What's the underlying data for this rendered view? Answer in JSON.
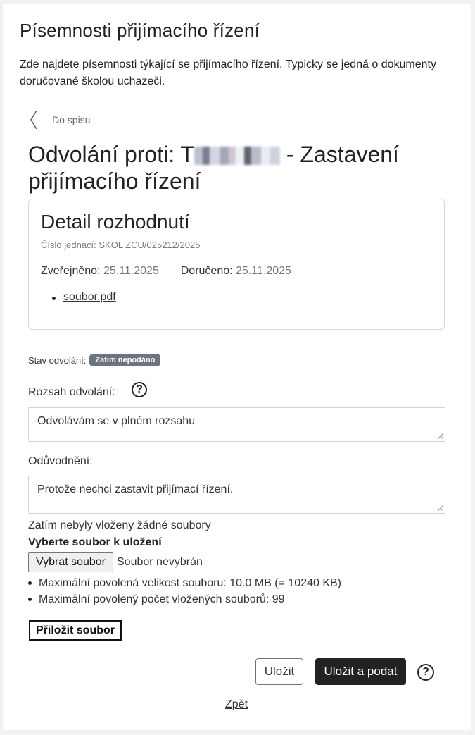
{
  "page": {
    "title": "Písemnosti přijímacího řízení",
    "intro": "Zde najdete písemnosti týkající se přijímacího řízení. Typicky se jedná o dokumenty doručované školou uchazeči."
  },
  "nav": {
    "back_to_file": "Do spisu",
    "back_icon": "chevron-left-icon"
  },
  "heading": {
    "prefix": "Odvolání proti: T",
    "suffix": " - Zastavení přijímacího řízení"
  },
  "decision": {
    "title": "Detail rozhodnutí",
    "reference": "Číslo jednací: SKOL ZCU/025212/2025",
    "published_label": "Zveřejněno:",
    "published_value": "25.11.2025",
    "delivered_label": "Doručeno:",
    "delivered_value": "25.11.2025",
    "files": [
      "soubor.pdf"
    ]
  },
  "status": {
    "label": "Stav odvolání:",
    "badge": "Zatím nepodáno",
    "badge_color": "#6c757d"
  },
  "form": {
    "scope_label": "Rozsah odvolání:",
    "scope_value": "Odvolávám se v plném rozsahu",
    "reason_label": "Odůvodnění:",
    "reason_value": "Protože nechci zastavit přijímací řízení.",
    "help_icon": "question-circle-icon"
  },
  "upload": {
    "no_files": "Zatím nebyly vloženy žádné soubory",
    "choose_label": "Vyberte soubor k uložení",
    "choose_button": "Vybrat soubor",
    "none_selected": "Soubor nevybrán",
    "limits": [
      "Maximální povolená velikost souboru: 10.0 MB (= 10240 KB)",
      "Maximální povolený počet vložených souborů: 99"
    ],
    "attach_button": "Přiložit soubor"
  },
  "actions": {
    "save": "Uložit",
    "save_submit": "Uložit a podat",
    "back": "Zpět",
    "primary_color": "#222222"
  }
}
